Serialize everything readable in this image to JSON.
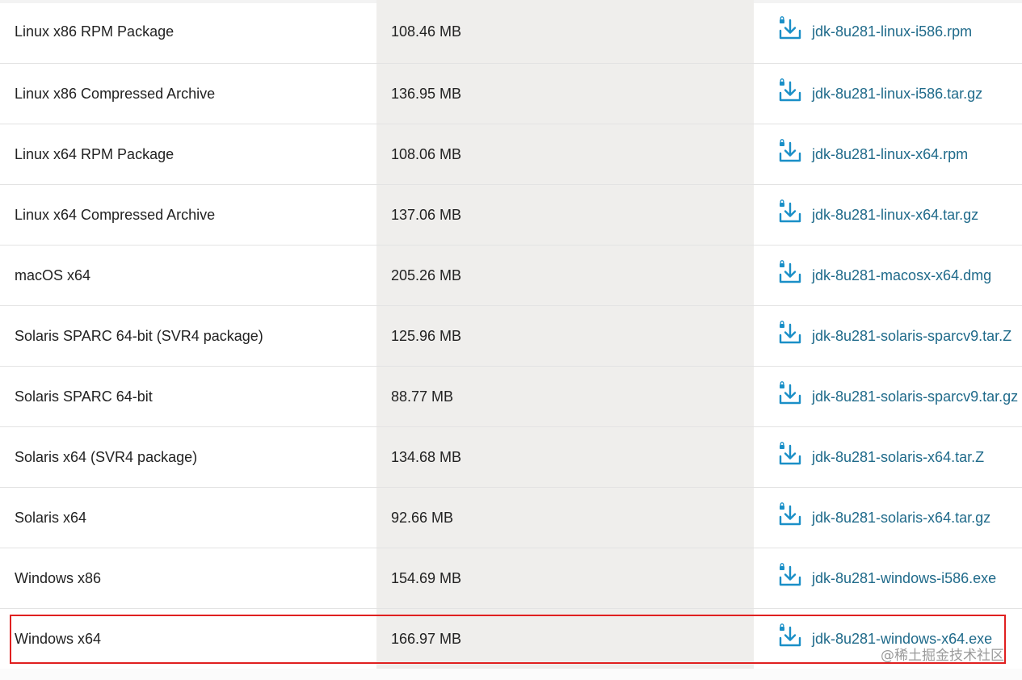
{
  "table": {
    "rows": [
      {
        "product": "Linux x86 RPM Package",
        "size": "108.46 MB",
        "file": "jdk-8u281-linux-i586.rpm"
      },
      {
        "product": "Linux x86 Compressed Archive",
        "size": "136.95 MB",
        "file": "jdk-8u281-linux-i586.tar.gz"
      },
      {
        "product": "Linux x64 RPM Package",
        "size": "108.06 MB",
        "file": "jdk-8u281-linux-x64.rpm"
      },
      {
        "product": "Linux x64 Compressed Archive",
        "size": "137.06 MB",
        "file": "jdk-8u281-linux-x64.tar.gz"
      },
      {
        "product": "macOS x64",
        "size": "205.26 MB",
        "file": "jdk-8u281-macosx-x64.dmg"
      },
      {
        "product": "Solaris SPARC 64-bit (SVR4 package)",
        "size": "125.96 MB",
        "file": "jdk-8u281-solaris-sparcv9.tar.Z"
      },
      {
        "product": "Solaris SPARC 64-bit",
        "size": "88.77 MB",
        "file": "jdk-8u281-solaris-sparcv9.tar.gz"
      },
      {
        "product": "Solaris x64 (SVR4 package)",
        "size": "134.68 MB",
        "file": "jdk-8u281-solaris-x64.tar.Z"
      },
      {
        "product": "Solaris x64",
        "size": "92.66 MB",
        "file": "jdk-8u281-solaris-x64.tar.gz"
      },
      {
        "product": "Windows x86",
        "size": "154.69 MB",
        "file": "jdk-8u281-windows-i586.exe"
      },
      {
        "product": "Windows x64",
        "size": "166.97 MB",
        "file": "jdk-8u281-windows-x64.exe"
      }
    ]
  },
  "icons": {
    "download": "download-lock-icon"
  },
  "colors": {
    "link": "#1f6a8a",
    "icon": "#1a8fc7",
    "highlight": "#e02020",
    "middle_column_bg": "#efeeec"
  },
  "watermark": {
    "text": "@稀土掘金技术社区"
  }
}
